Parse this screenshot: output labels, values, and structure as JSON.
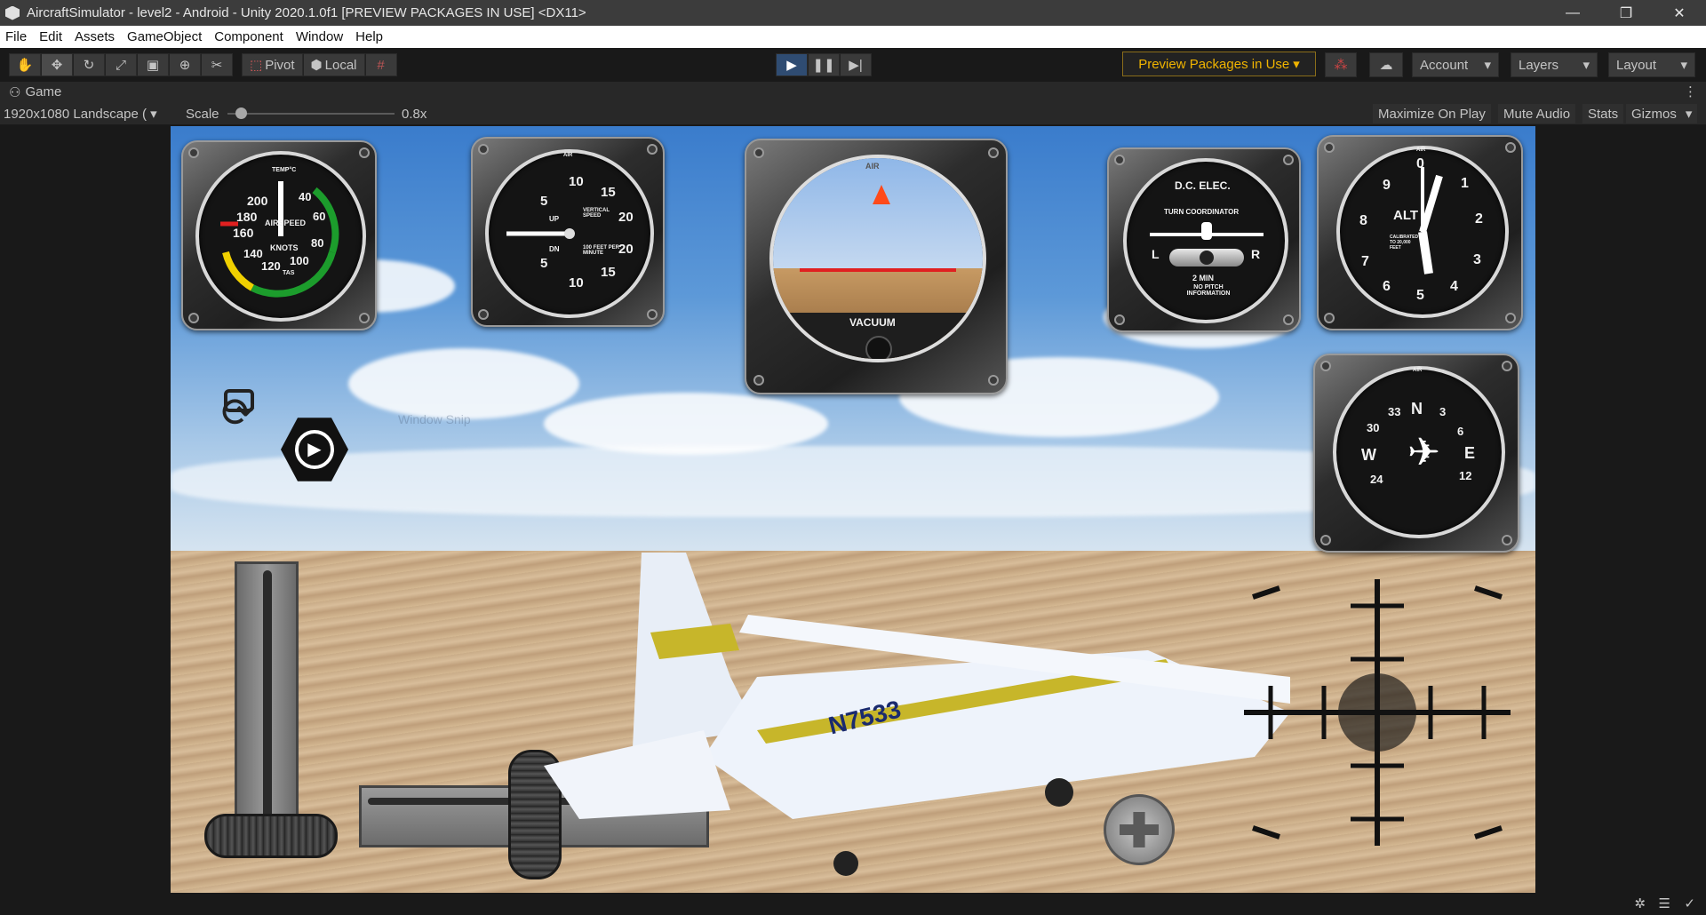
{
  "window": {
    "title": "AircraftSimulator - level2 - Android - Unity 2020.1.0f1 [PREVIEW PACKAGES IN USE] <DX11>",
    "minimize_glyph": "—",
    "restore_glyph": "❐",
    "close_glyph": "✕"
  },
  "menu": [
    "File",
    "Edit",
    "Assets",
    "GameObject",
    "Component",
    "Window",
    "Help"
  ],
  "toolbar": {
    "tools": [
      "hand-tool",
      "move-tool",
      "rotate-tool",
      "scale-tool",
      "rect-tool",
      "transform-tool",
      "custom-tool"
    ],
    "pivot_label": "Pivot",
    "local_label": "Local",
    "preview_packages": "Preview Packages in Use",
    "account": "Account",
    "layers": "Layers",
    "layout": "Layout"
  },
  "tab": {
    "label": "Game"
  },
  "gamebar": {
    "resolution": "1920x1080 Landscape (",
    "scale_label": "Scale",
    "scale_value": "0.8x",
    "scale_fraction": 0.05,
    "maximize_on_play": "Maximize On Play",
    "mute_audio": "Mute Audio",
    "stats": "Stats",
    "gizmos": "Gizmos"
  },
  "instruments": {
    "airspeed": {
      "numbers": [
        "200",
        "180",
        "160",
        "140",
        "120",
        "100",
        "80",
        "60",
        "40"
      ],
      "label": "AIRSPEED",
      "unit": "KNOTS",
      "temp": "TEMP°C",
      "tas": "TAS"
    },
    "vsi": {
      "numbers": [
        "10",
        "15",
        "20",
        "5",
        "20",
        "5",
        "10",
        "15"
      ],
      "up": "UP",
      "dn": "DN",
      "caption": "VERTICAL SPEED",
      "caption2": "100 FEET PER MINUTE",
      "brand": "AIR"
    },
    "attitude": {
      "brand": "AIR",
      "label": "VACUUM"
    },
    "turn": {
      "title": "D.C. ELEC.",
      "caption": "TURN COORDINATOR",
      "left": "L",
      "right": "R",
      "minutes": "2 MIN",
      "note": "NO PITCH INFORMATION"
    },
    "altimeter": {
      "numbers": [
        "0",
        "1",
        "2",
        "3",
        "4",
        "5",
        "6",
        "7",
        "8",
        "9"
      ],
      "label": "ALT",
      "caption": "CALIBRATED TO 20,000 FEET",
      "brand": "AIR"
    },
    "heading": {
      "marks": [
        "N",
        "3",
        "6",
        "E",
        "12",
        "24",
        "W",
        "30",
        "33"
      ],
      "brand": "AIR"
    }
  },
  "scene": {
    "tail_number": "N7533",
    "watermark": "Window Snip"
  },
  "colors": {
    "accent_play": "#2f4c72",
    "preview_text": "#f0b400"
  }
}
